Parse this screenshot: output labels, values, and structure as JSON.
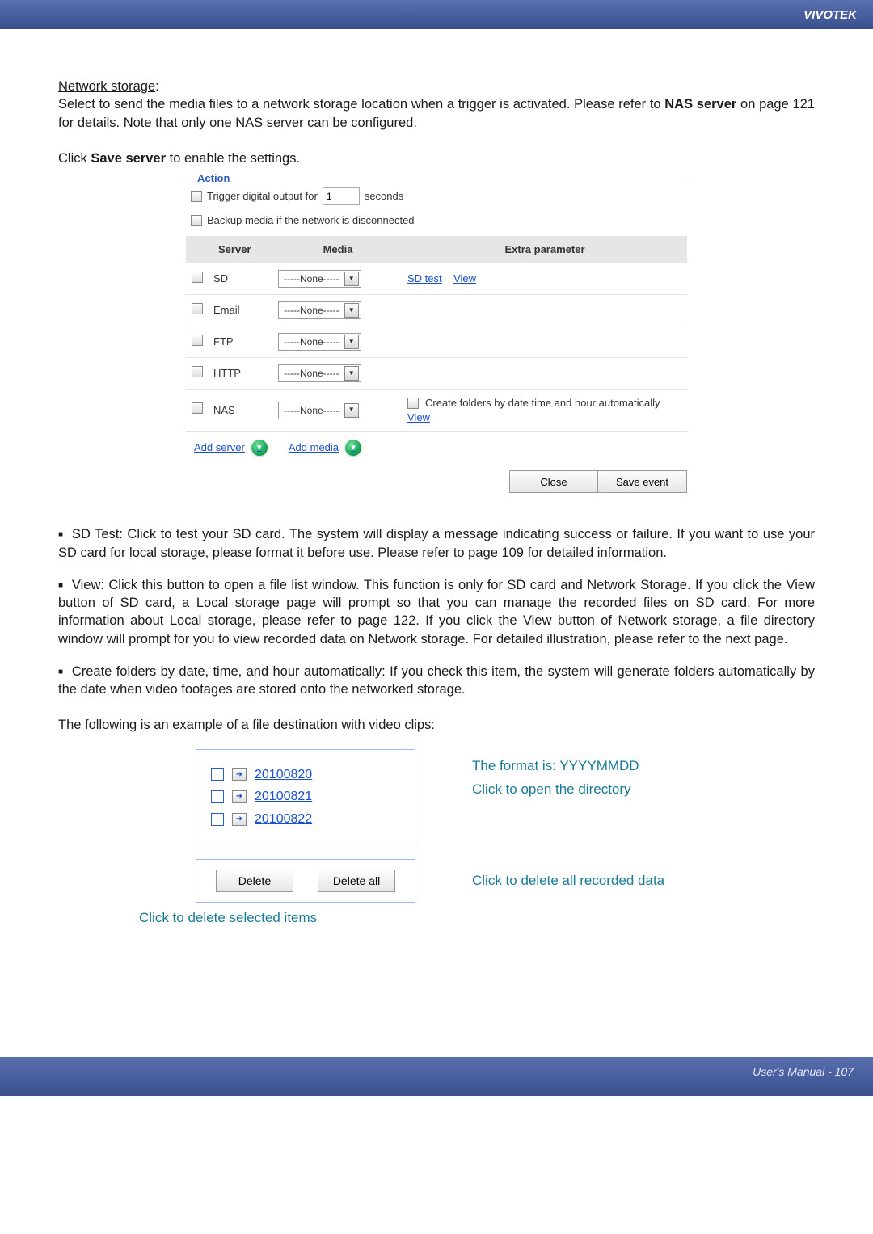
{
  "header": {
    "brand": "VIVOTEK"
  },
  "intro": {
    "heading": "Network storage",
    "text_pre": "Select to send the media files to a network storage location when a trigger is activated. Please refer to ",
    "bold": "NAS server",
    "text_post": " on page 121 for details. Note that only one NAS server can be configured.",
    "click_pre": "Click ",
    "click_bold": "Save server",
    "click_post": " to enable the settings."
  },
  "action": {
    "legend": "Action",
    "trigger_pre": "Trigger digital output for",
    "trigger_val": "1",
    "trigger_post": "seconds",
    "backup_label": "Backup media if the network is disconnected",
    "headers": {
      "server": "Server",
      "media": "Media",
      "extra": "Extra parameter"
    },
    "none_label": "-----None-----",
    "rows": {
      "sd": {
        "name": "SD",
        "extra_links": [
          "SD test",
          "View"
        ]
      },
      "email": {
        "name": "Email"
      },
      "ftp": {
        "name": "FTP"
      },
      "http": {
        "name": "HTTP"
      },
      "nas": {
        "name": "NAS",
        "auto_label": "Create folders by date time and hour automatically",
        "view": "View"
      }
    },
    "add_server": "Add server",
    "add_media": "Add media",
    "close": "Close",
    "save": "Save event"
  },
  "bullets": {
    "sd_test": "SD Test: Click to test your SD card. The system will display a message indicating success or failure. If you want to use your SD card for local storage, please format it before use. Please refer to page 109 for detailed information.",
    "view": "View: Click this button to open a file list window. This function is only for SD card and Network Storage. If you click the View button of SD card, a Local storage page will prompt so that you can manage the recorded files on SD card. For more information about Local storage, please refer to page 122. If you click the View button of Network storage, a file directory window will prompt for you to view recorded data on Network storage. For detailed illustration, please refer to the next page.",
    "create": "Create folders by date, time, and hour automatically: If you check this item, the system will generate folders automatically by the date when video footages are stored onto the networked storage."
  },
  "example_intro": "The following is an example of a file destination with video clips:",
  "folders": [
    "20100820",
    "20100821",
    "20100822"
  ],
  "delete_btn": "Delete",
  "delete_all_btn": "Delete all",
  "anno": {
    "format": "The format is: YYYYMMDD",
    "open": "Click to open the directory",
    "delete_all": "Click to delete all recorded data",
    "delete_sel": "Click to delete selected items"
  },
  "footer": {
    "label": "User's Manual - 107"
  }
}
